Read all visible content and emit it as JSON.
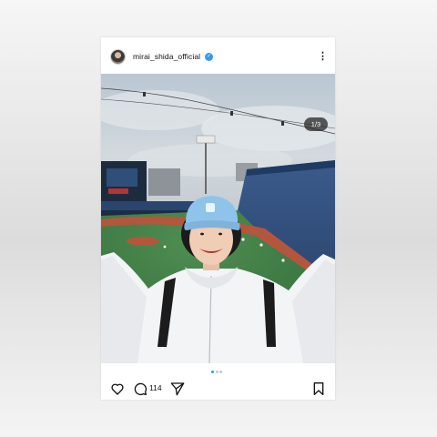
{
  "post": {
    "username": "mirai_shida_official",
    "verified": true,
    "more_icon": "more-vertical-icon",
    "image_counter": "1/3",
    "carousel": {
      "total": 3,
      "active": 1
    },
    "comment_count": "114"
  },
  "icons": {
    "like": "heart-icon",
    "comment": "comment-icon",
    "share": "paper-plane-icon",
    "save": "bookmark-icon",
    "verified": "verified-badge-icon"
  },
  "colors": {
    "accent": "#3897f0",
    "cap": "#8fc3ea",
    "hoodie": "#f3f4f6",
    "field": "#3d7b45",
    "dirt": "#b4563c"
  }
}
